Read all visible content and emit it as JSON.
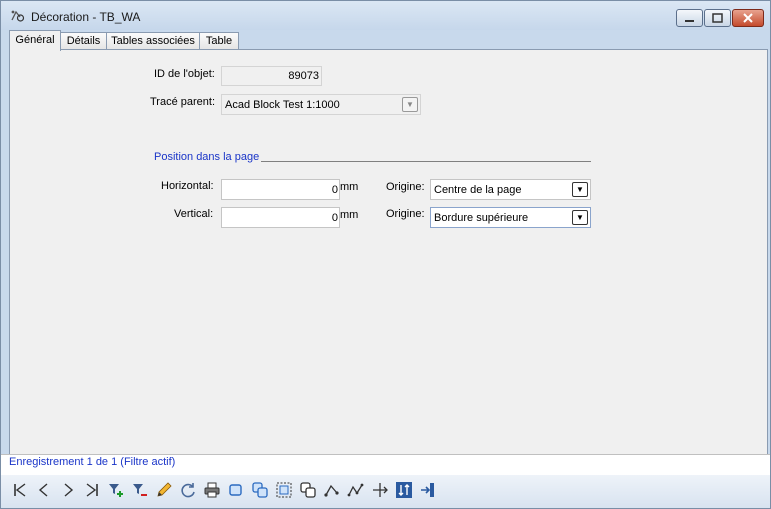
{
  "window": {
    "title": "Décoration - TB_WA"
  },
  "tabs": [
    {
      "label": "Général"
    },
    {
      "label": "Détails"
    },
    {
      "label": "Tables associées"
    },
    {
      "label": "Table"
    }
  ],
  "form": {
    "id_label": "ID de l'objet:",
    "id_value": "89073",
    "parent_label": "Tracé parent:",
    "parent_value": "Acad Block Test 1:1000",
    "section_title": "Position dans la page",
    "horizontal_label": "Horizontal:",
    "horizontal_value": "0",
    "horizontal_unit": "mm",
    "vertical_label": "Vertical:",
    "vertical_value": "0",
    "vertical_unit": "mm",
    "origin1_label": "Origine:",
    "origin1_value": "Centre de la page",
    "origin2_label": "Origine:",
    "origin2_value": "Bordure supérieure"
  },
  "status": {
    "text": "Enregistrement 1 de 1 (Filtre actif)"
  },
  "toolbar_icons": [
    "first-record-icon",
    "previous-record-icon",
    "next-record-icon",
    "last-record-icon",
    "add-filter-icon",
    "remove-filter-icon",
    "edit-pencil-icon",
    "refresh-icon",
    "print-icon",
    "select-object-icon",
    "select-multiple-icon",
    "select-frame-icon",
    "copy-icon",
    "route-icon",
    "route-multi-icon",
    "move-icon",
    "sort-icon",
    "exit-icon"
  ]
}
